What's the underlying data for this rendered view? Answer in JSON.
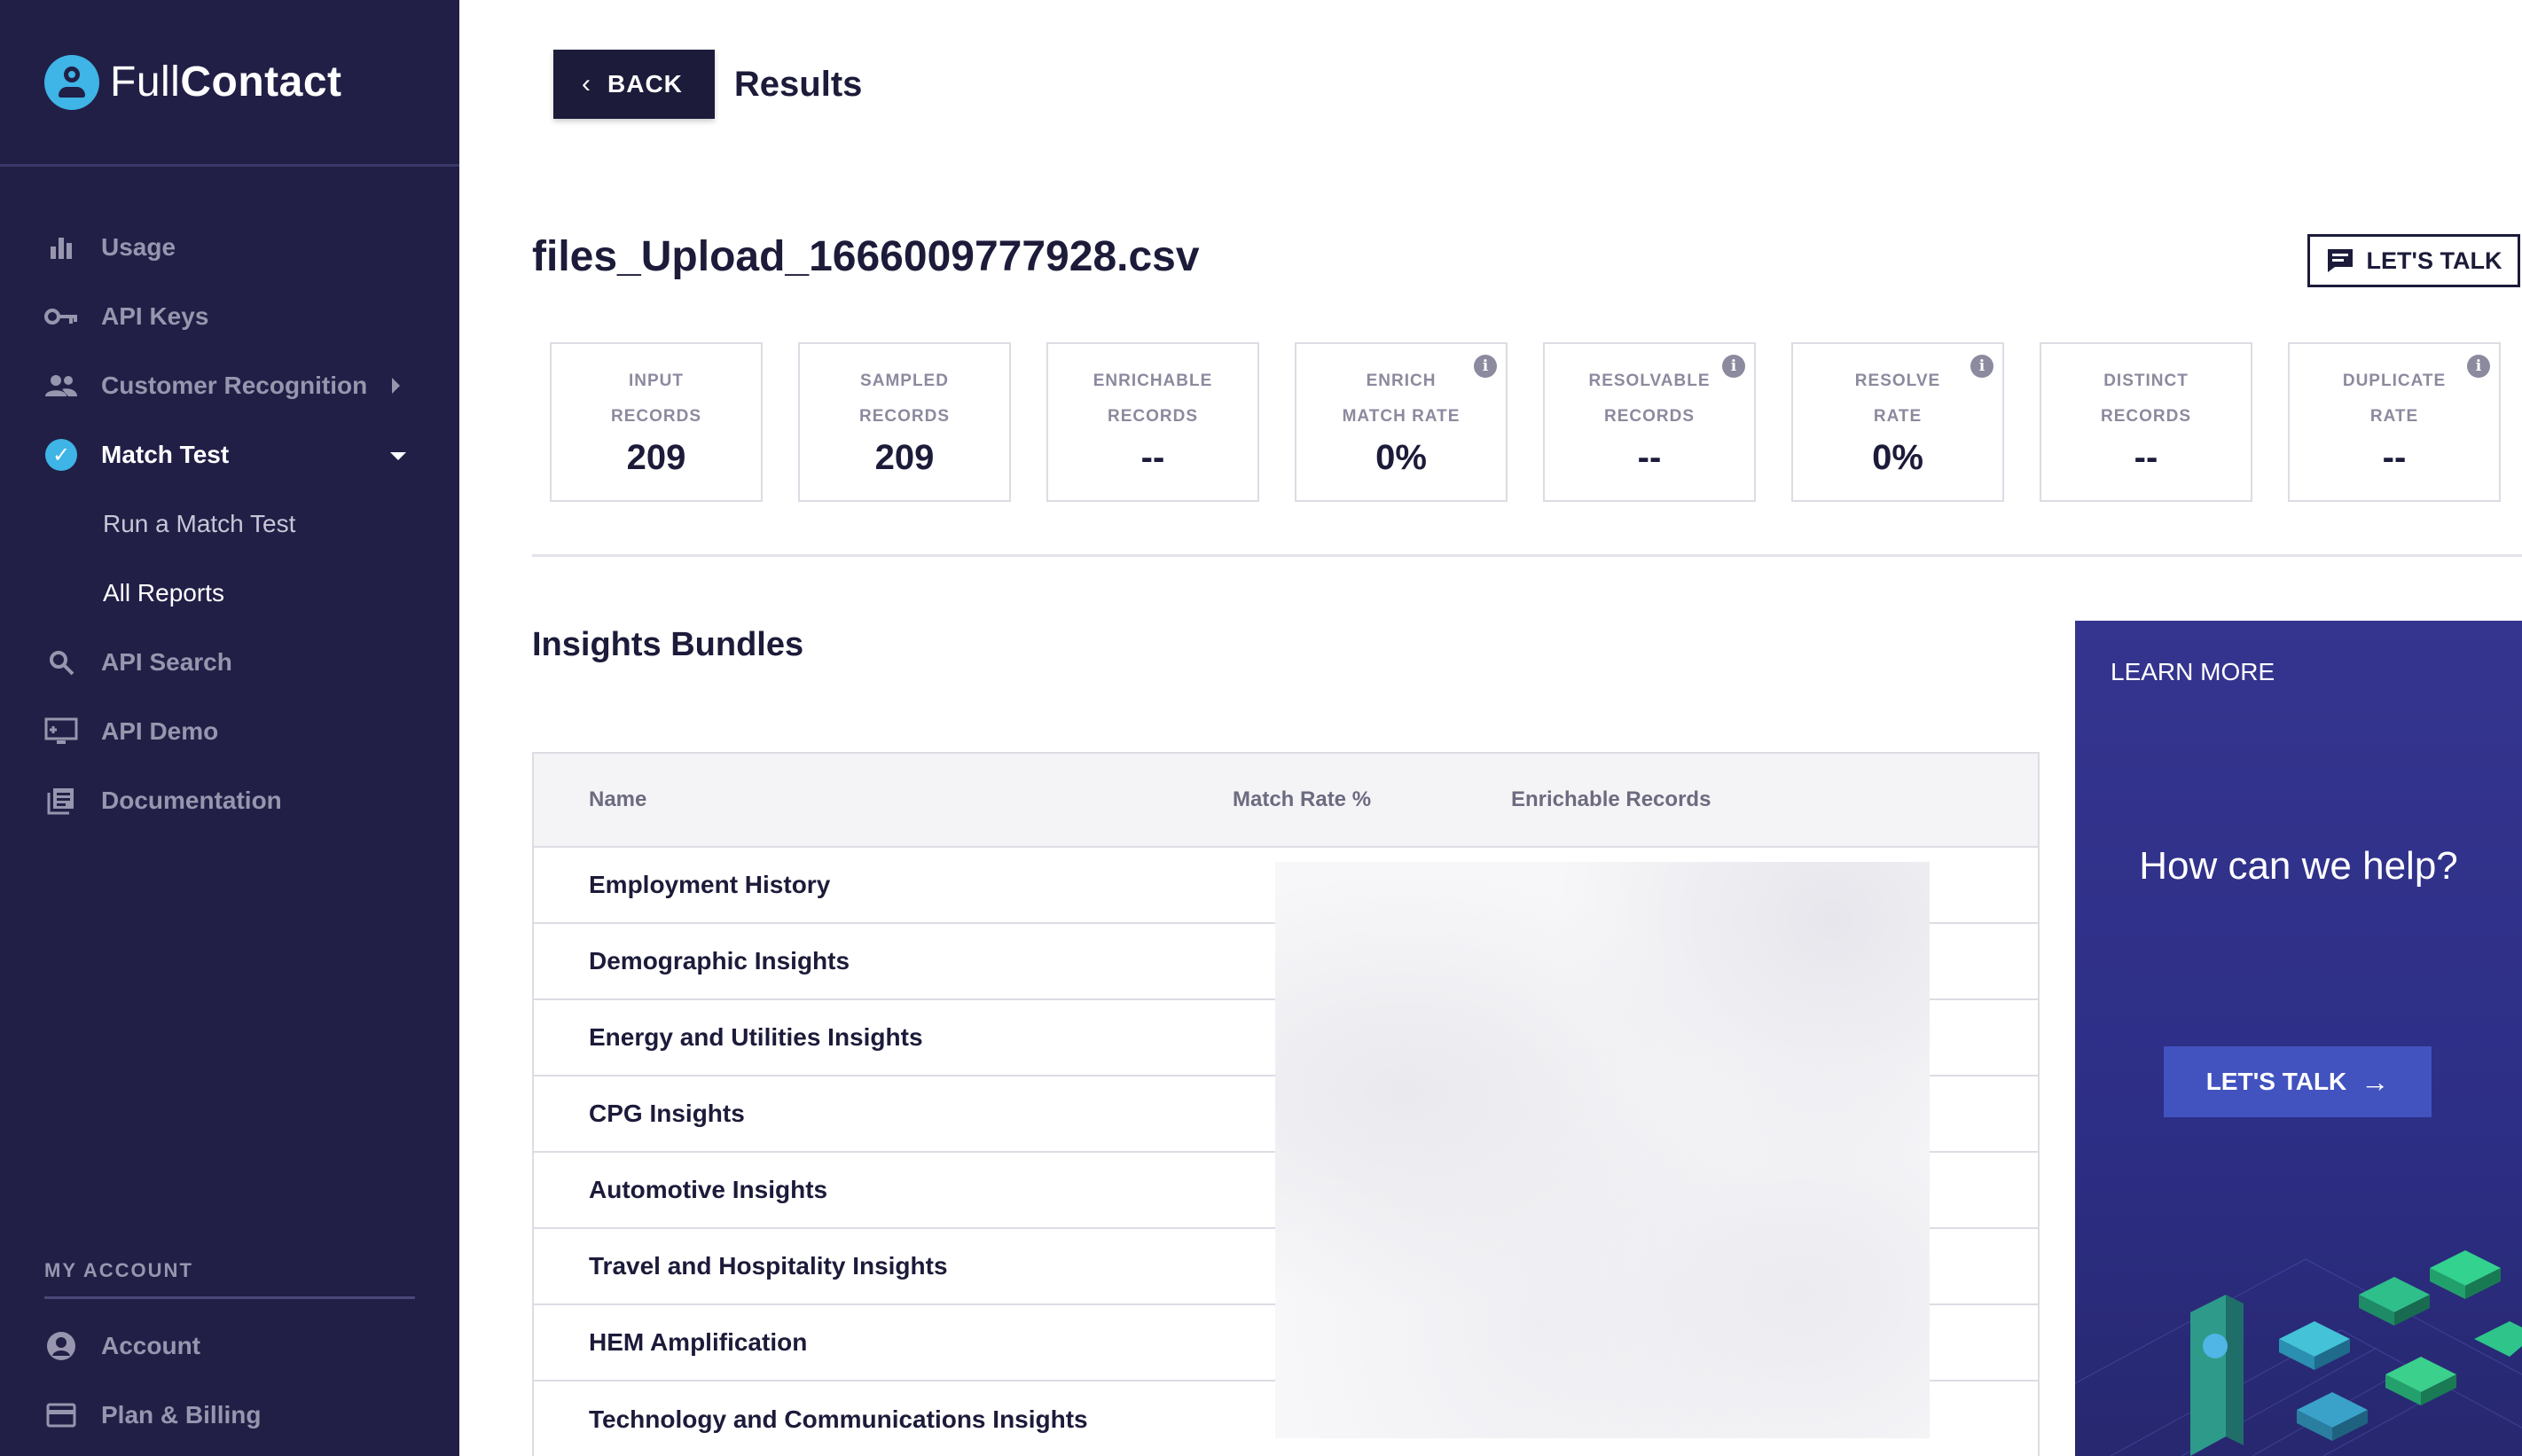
{
  "brand": {
    "name_light": "Full",
    "name_bold": "Contact"
  },
  "sidebar": {
    "items": [
      {
        "label": "Usage",
        "icon": "bar-chart-icon"
      },
      {
        "label": "API Keys",
        "icon": "key-icon"
      },
      {
        "label": "Customer Recognition",
        "icon": "people-icon"
      },
      {
        "label": "Match Test",
        "icon": "check-circle-icon"
      }
    ],
    "match_test_sub": [
      {
        "label": "Run a Match Test"
      },
      {
        "label": "All Reports"
      }
    ],
    "items_after": [
      {
        "label": "API Search",
        "icon": "search-icon"
      },
      {
        "label": "API Demo",
        "icon": "monitor-icon"
      },
      {
        "label": "Documentation",
        "icon": "docs-icon"
      }
    ],
    "account_section_label": "MY ACCOUNT",
    "account_items": [
      {
        "label": "Account",
        "icon": "account-circle-icon"
      },
      {
        "label": "Plan & Billing",
        "icon": "credit-card-icon"
      }
    ]
  },
  "header": {
    "back_label": "BACK",
    "title": "Results"
  },
  "file": {
    "name": "files_Upload_1666009777928.csv",
    "talk_label": "LET'S TALK"
  },
  "stats": [
    {
      "line1": "INPUT",
      "line2": "RECORDS",
      "value": "209",
      "info": false
    },
    {
      "line1": "SAMPLED",
      "line2": "RECORDS",
      "value": "209",
      "info": false
    },
    {
      "line1": "ENRICHABLE",
      "line2": "RECORDS",
      "value": "--",
      "info": false
    },
    {
      "line1": "ENRICH",
      "line2": "MATCH RATE",
      "value": "0%",
      "info": true
    },
    {
      "line1": "RESOLVABLE",
      "line2": "RECORDS",
      "value": "--",
      "info": true
    },
    {
      "line1": "RESOLVE",
      "line2": "RATE",
      "value": "0%",
      "info": true
    },
    {
      "line1": "DISTINCT",
      "line2": "RECORDS",
      "value": "--",
      "info": false
    },
    {
      "line1": "DUPLICATE",
      "line2": "RATE",
      "value": "--",
      "info": true
    }
  ],
  "bundles": {
    "title": "Insights Bundles",
    "columns": [
      "Name",
      "Match Rate %",
      "Enrichable Records"
    ],
    "rows": [
      "Employment History",
      "Demographic Insights",
      "Energy and Utilities Insights",
      "CPG Insights",
      "Automotive Insights",
      "Travel and Hospitality Insights",
      "HEM Amplification",
      "Technology and Communications Insights"
    ]
  },
  "promo": {
    "learn_more": "LEARN MORE",
    "headline": "How can we help?",
    "button_label": "LET'S TALK",
    "accent_color": "#4253c0"
  }
}
